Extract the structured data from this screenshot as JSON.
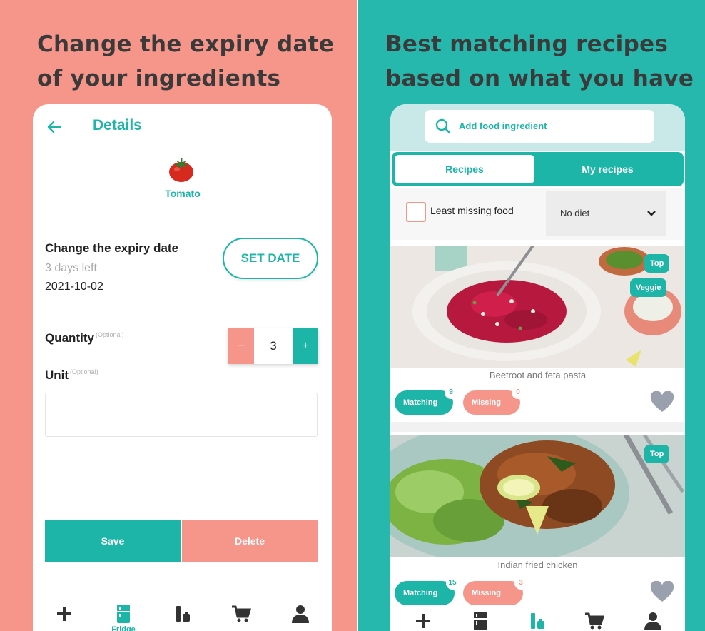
{
  "colors": {
    "coral": "#f6958a",
    "teal": "#1cb5a8",
    "teal_bg": "#27b8ad",
    "text_dark": "#3a3a3a"
  },
  "left_panel": {
    "headline_line1": "Change the expiry date",
    "headline_line2": "of your ingredients",
    "screen": {
      "back_icon": "arrow-left-icon",
      "title": "Details",
      "ingredient_icon": "tomato-icon",
      "ingredient_name": "Tomato",
      "expiry_heading": "Change the expiry date",
      "days_left": "3 days left",
      "expiry_date": "2021-10-02",
      "set_date_label": "SET DATE",
      "quantity_label": "Quantity",
      "quantity_optional": "(Optional)",
      "stepper": {
        "minus": "−",
        "value": "3",
        "plus": "+"
      },
      "unit_label": "Unit",
      "unit_optional": "(Optional)",
      "unit_value": "",
      "save_label": "Save",
      "delete_label": "Delete",
      "nav": [
        {
          "icon": "plus-icon",
          "label": ""
        },
        {
          "icon": "fridge-icon",
          "label": "Fridge",
          "active": true
        },
        {
          "icon": "bottles-icon",
          "label": ""
        },
        {
          "icon": "cart-icon",
          "label": ""
        },
        {
          "icon": "user-icon",
          "label": ""
        }
      ]
    }
  },
  "right_panel": {
    "headline_line1": "Best matching recipes",
    "headline_line2": "based on what you have",
    "screen": {
      "search_placeholder": "Add food ingredient",
      "tabs": [
        {
          "label": "Recipes",
          "active": true
        },
        {
          "label": "My recipes",
          "active": false
        }
      ],
      "filter": {
        "least_missing_label": "Least missing food",
        "checked": false,
        "diet_value": "No diet"
      },
      "recipes": [
        {
          "title": "Beetroot and feta pasta",
          "badges": [
            "Top",
            "Veggie"
          ],
          "matching_label": "Matching",
          "matching_count": "9",
          "missing_label": "Missing",
          "missing_count": "0"
        },
        {
          "title": "Indian fried chicken",
          "badges": [
            "Top"
          ],
          "matching_label": "Matching",
          "matching_count": "15",
          "missing_label": "Missing",
          "missing_count": "3"
        }
      ],
      "nav": [
        {
          "icon": "plus-icon"
        },
        {
          "icon": "fridge-icon"
        },
        {
          "icon": "bottles-icon",
          "active": true
        },
        {
          "icon": "cart-icon"
        },
        {
          "icon": "user-icon"
        }
      ]
    }
  }
}
